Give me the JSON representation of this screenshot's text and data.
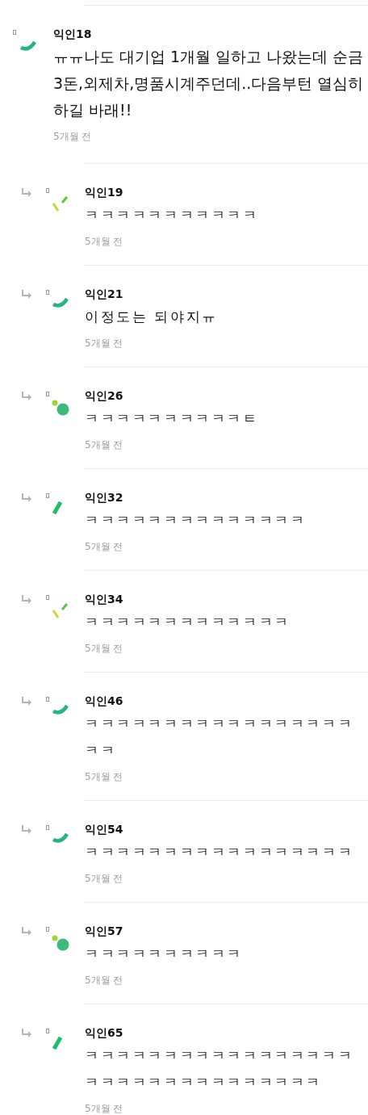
{
  "comments": [
    {
      "author": "익인18",
      "text": "ㅠㅠ나도 대기업 1개월 일하고 나왔는데 순금 3돈,외제차,명품시계주던데..다음부턴 열심히 하길 바래!!",
      "time": "5개월 전",
      "reply": false,
      "kind": "arc"
    },
    {
      "author": "익인19",
      "text": "ㅋㅋㅋㅋㅋㅋㅋㅋㅋㅋㅋ",
      "time": "5개월 전",
      "reply": true,
      "kind": "ticks"
    },
    {
      "author": "익인21",
      "text": "이정도는 되야지ㅠ",
      "time": "5개월 전",
      "reply": true,
      "kind": "arc"
    },
    {
      "author": "익인26",
      "text": "ㅋㅋㅋㅋㅋㅋㅋㅋㅋㅋㅌ",
      "time": "5개월 전",
      "reply": true,
      "kind": "dots"
    },
    {
      "author": "익인32",
      "text": "ㅋㅋㅋㅋㅋㅋㅋㅋㅋㅋㅋㅋㅋㅋ",
      "time": "5개월 전",
      "reply": true,
      "kind": "bar"
    },
    {
      "author": "익인34",
      "text": "ㅋㅋㅋㅋㅋㅋㅋㅋㅋㅋㅋㅋㅋ",
      "time": "5개월 전",
      "reply": true,
      "kind": "ticks"
    },
    {
      "author": "익인46",
      "text": "ㅋㅋㅋㅋㅋㅋㅋㅋㅋㅋㅋㅋㅋㅋㅋㅋㅋㅋㅋ",
      "time": "5개월 전",
      "reply": true,
      "kind": "arc"
    },
    {
      "author": "익인54",
      "text": "ㅋㅋㅋㅋㅋㅋㅋㅋㅋㅋㅋㅋㅋㅋㅋㅋㅋ",
      "time": "5개월 전",
      "reply": true,
      "kind": "arc"
    },
    {
      "author": "익인57",
      "text": "ㅋㅋㅋㅋㅋㅋㅋㅋㅋㅋ",
      "time": "5개월 전",
      "reply": true,
      "kind": "dots"
    },
    {
      "author": "익인65",
      "text": "ㅋㅋㅋㅋㅋㅋㅋㅋㅋㅋㅋㅋㅋㅋㅋㅋㅋㅋㅋㅋㅋㅋㅋㅋㅋㅋㅋㅋㅋㅋㅋㅋ",
      "time": "5개월 전",
      "reply": true,
      "kind": "bar"
    }
  ]
}
